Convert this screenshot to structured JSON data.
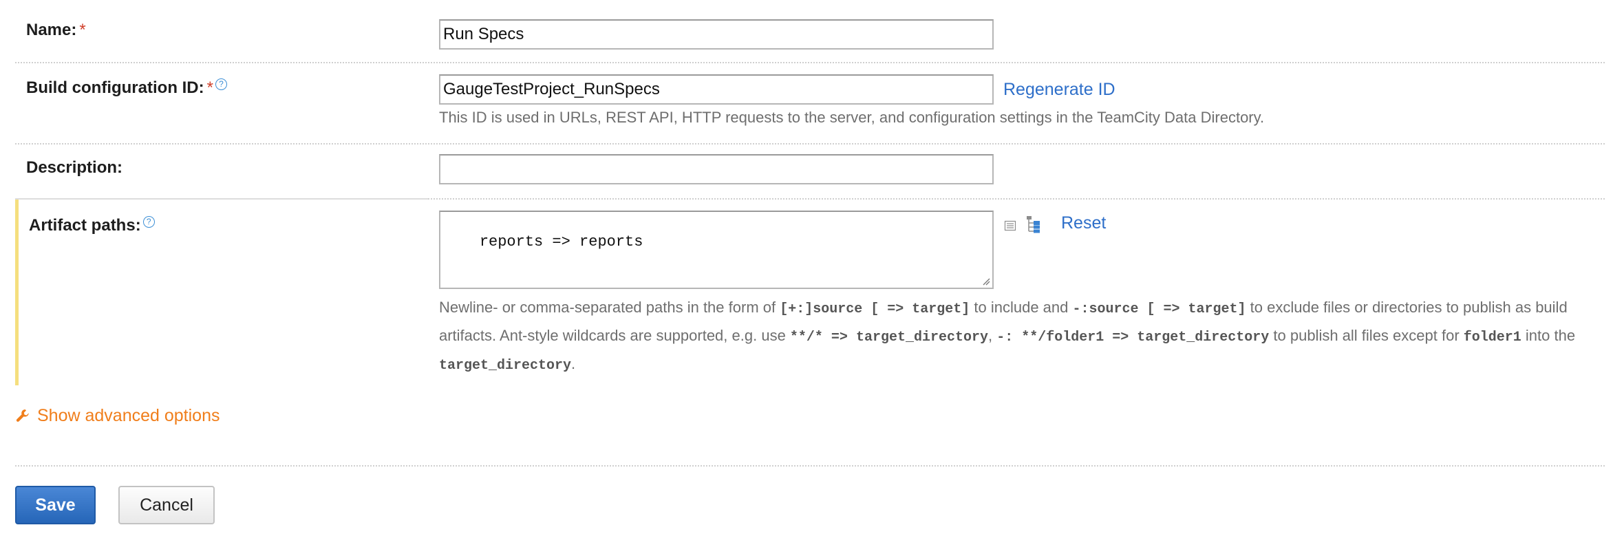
{
  "form": {
    "name": {
      "label": "Name:",
      "required_mark": "*",
      "value": "Run Specs"
    },
    "build_config_id": {
      "label": "Build configuration ID:",
      "required_mark": "*",
      "help_glyph": "?",
      "value": "GaugeTestProject_RunSpecs",
      "regenerate_label": "Regenerate ID",
      "note": "This ID is used in URLs, REST API, HTTP requests to the server, and configuration settings in the TeamCity Data Directory."
    },
    "description": {
      "label": "Description:",
      "value": ""
    },
    "artifact_paths": {
      "label": "Artifact paths:",
      "help_glyph": "?",
      "value": "reports => reports",
      "reset_label": "Reset",
      "note_parts": {
        "t1": "Newline- or comma-separated paths in the form of ",
        "c1": "[+:]source [ => target]",
        "t2": " to include and ",
        "c2": "-:source [ => target]",
        "t3": " to exclude files or directories to publish as build artifacts. Ant-style wildcards are supported, e.g. use ",
        "c3": "**/* => target_directory",
        "t4": ", ",
        "c4": "-: **/folder1 => target_directory",
        "t5": " to publish all files except for ",
        "c5": "folder1",
        "t6": " into the ",
        "c6": "target_directory",
        "t7": "."
      }
    },
    "advanced_label": "Show advanced options",
    "save_label": "Save",
    "cancel_label": "Cancel"
  },
  "colors": {
    "link": "#2e6fc9",
    "advanced": "#f07e1b",
    "required": "#d0402b",
    "accent_bar": "#f5df7e",
    "save_button": "#2666b8"
  },
  "icons": {
    "help": "question-circle-icon",
    "list": "list-icon",
    "tree": "tree-browse-icon",
    "wrench": "wrench-icon"
  }
}
